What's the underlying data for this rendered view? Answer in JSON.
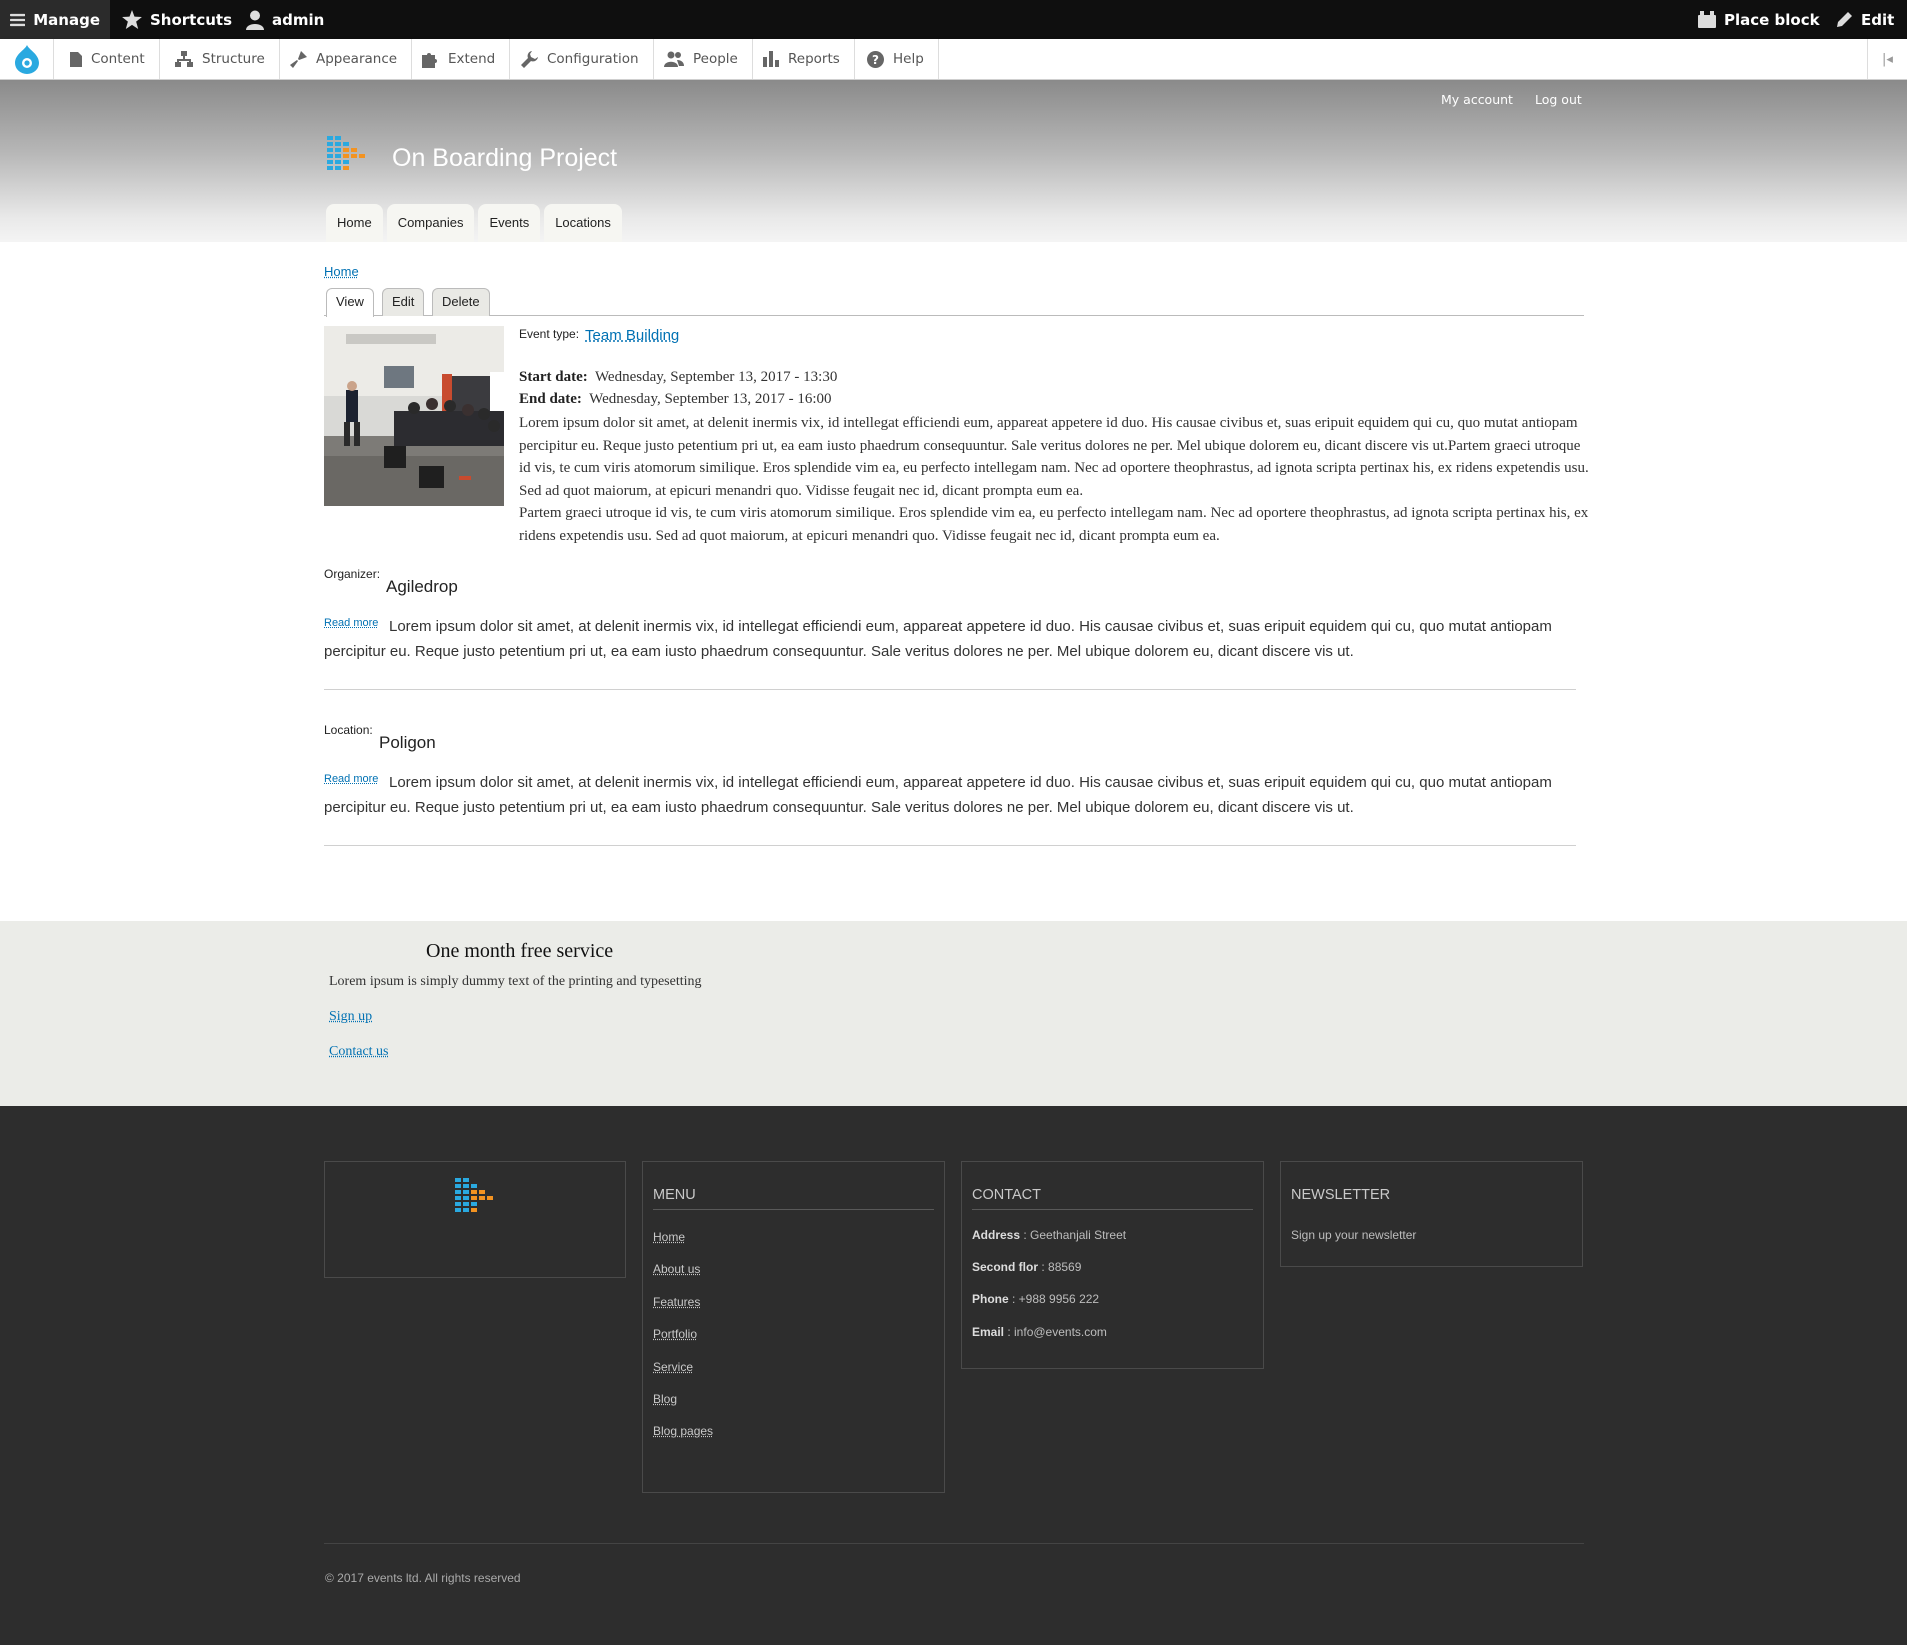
{
  "toolbar": {
    "manage": "Manage",
    "shortcuts": "Shortcuts",
    "user": "admin",
    "place_block": "Place block",
    "edit": "Edit"
  },
  "tray": {
    "items": [
      "Content",
      "Structure",
      "Appearance",
      "Extend",
      "Configuration",
      "People",
      "Reports",
      "Help"
    ]
  },
  "header": {
    "my_account": "My account",
    "log_out": "Log out",
    "site_name": "On Boarding Project",
    "nav": [
      "Home",
      "Companies",
      "Events",
      "Locations"
    ]
  },
  "content": {
    "breadcrumb": "Home",
    "tabs": [
      "View",
      "Edit",
      "Delete"
    ],
    "event_type_label": "Event type:",
    "event_type": "Team Building",
    "start_label": "Start date:",
    "start_value": "Wednesday, September 13, 2017 - 13:30",
    "end_label": "End date:",
    "end_value": "Wednesday, September 13, 2017 - 16:00",
    "body_p1": "Lorem ipsum dolor sit amet, at delenit inermis vix, id intellegat efficiendi eum, appareat appetere id duo. His causae civibus et, suas eripuit equidem qui cu, quo mutat antiopam percipitur eu. Reque justo petentium pri ut, ea eam iusto phaedrum consequuntur. Sale veritus dolores ne per. Mel ubique dolorem eu, dicant discere vis ut.Partem graeci utroque id vis, te cum viris atomorum similique. Eros splendide vim ea, eu perfecto intellegam nam. Nec ad oportere theophrastus, ad ignota scripta pertinax his, ex ridens expetendis usu. Sed ad quot maiorum, at epicuri menandri quo. Vidisse feugait nec id, dicant prompta eum ea.",
    "body_p2": "Partem graeci utroque id vis, te cum viris atomorum similique. Eros splendide vim ea, eu perfecto intellegam nam. Nec ad oportere theophrastus, ad ignota scripta pertinax his, ex ridens expetendis usu. Sed ad quot maiorum, at epicuri menandri quo. Vidisse feugait nec id, dicant prompta eum ea.",
    "organizer": {
      "label": "Organizer:",
      "name": "Agiledrop",
      "read_more": "Read more",
      "text": "Lorem ipsum dolor sit amet, at delenit inermis vix, id intellegat efficiendi eum, appareat appetere id duo. His causae civibus et, suas eripuit equidem qui cu, quo mutat antiopam percipitur eu. Reque justo petentium pri ut, ea eam iusto phaedrum consequuntur. Sale veritus dolores ne per. Mel ubique dolorem eu, dicant discere vis ut."
    },
    "location": {
      "label": "Location:",
      "name": "Poligon",
      "read_more": "Read more",
      "text": "Lorem ipsum dolor sit amet, at delenit inermis vix, id intellegat efficiendi eum, appareat appetere id duo. His causae civibus et, suas eripuit equidem qui cu, quo mutat antiopam percipitur eu. Reque justo petentium pri ut, ea eam iusto phaedrum consequuntur. Sale veritus dolores ne per. Mel ubique dolorem eu, dicant discere vis ut."
    }
  },
  "promo": {
    "title": "One month free service",
    "text": "Lorem ipsum is simply dummy text of the printing and typesetting",
    "signup": "Sign up",
    "contact": "Contact us"
  },
  "footer": {
    "menu_title": "MENU",
    "menu": [
      "Home",
      "About us",
      "Features",
      "Portfolio",
      "Service",
      "Blog",
      "Blog pages"
    ],
    "contact_title": "CONTACT",
    "contact": [
      {
        "label": "Address",
        "value": " : Geethanjali Street"
      },
      {
        "label": "Second flor",
        "value": " : 88569"
      },
      {
        "label": "Phone",
        "value": " : +988 9956 222"
      },
      {
        "label": "Email",
        "value": " : info@events.com"
      }
    ],
    "newsletter_title": "NEWSLETTER",
    "newsletter_text": "Sign up your newsletter",
    "copyright": "© 2017 events ltd. All rights reserved"
  },
  "colors": {
    "link": "#0071b3",
    "toolbar_bg": "#0f0f0f",
    "footer_bg": "#2d2d2d",
    "promo_bg": "#ebece8",
    "logo_blue": "#2aa9e0",
    "logo_orange": "#f39321"
  }
}
